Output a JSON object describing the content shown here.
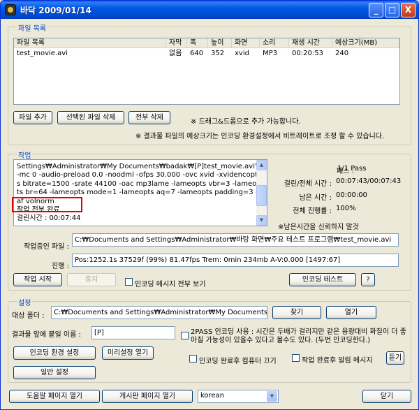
{
  "window": {
    "title": "바닥 2009/01/14",
    "btn_min": "_",
    "btn_max": "□",
    "btn_close": "X"
  },
  "file_list": {
    "group_label": "파일 목록",
    "columns": [
      "파일 목록",
      "자막",
      "폭",
      "높이",
      "화면",
      "소리",
      "재생 시간",
      "예상크기(MB)"
    ],
    "rows": [
      [
        "test_movie.avi",
        "없음",
        "640",
        "352",
        "xvid",
        "MP3",
        "00:20:53",
        "240"
      ]
    ],
    "add_button": "파일 추가",
    "delete_selected_button": "선택된 파일 삭제",
    "delete_all_button": "전부 삭제",
    "drag_hint": "※ 드래그&드롭으로 추가 가능합니다.",
    "size_hint": "※ 결과물 파일의 예상크기는 인코딩 환경설정에서 비트레이트로 조정 할 수 있습니다."
  },
  "job": {
    "group_label": "작업",
    "log": "Settings₩Administrator₩My Documents₩badak₩[P]test_movie.avi\" -mc 0 -audio-preload 0.0 -noodml -ofps 30.000 -ovc xvid -xvidencopts bitrate=1500 -srate 44100 -oac mp3lame -lameopts vbr=3  -lameopts br=64 -lameopts mode=1 -lameopts aq=7 -lameopts padding=3 -af volnorm\n작업 전부 완료\n걸린시간 : 00:07:44",
    "pass_label": "패스 :",
    "pass_value": "1/1 Pass",
    "elapsed_label": "걸린/전체 시간 :",
    "elapsed_value": "00:07:43/00:07:43",
    "remaining_label": "남은 시간 :",
    "remaining_value": "00:00:00",
    "progress_label": "전체 진행률 :",
    "progress_value": "100%",
    "note": "※남은시간을 신뢰하지 말것",
    "current_file_label": "작업중인 파일 :",
    "current_file_value": "C:₩Documents and Settings₩Administrator₩바탕 화면₩주요 테스트 프로그램₩test_movie.avi",
    "status_label": "진행 :",
    "status_value": "Pos:1252.1s  37529f (99%) 81.47fps Trem:    0min 234mb  A-V:0.000 [1497:67]",
    "start_button": "작업 시작",
    "stop_button": "중지",
    "show_all_messages": "인코딩 메시지 전부 보기",
    "encoding_test_button": "인코딩 테스트",
    "help_button": "?"
  },
  "settings": {
    "group_label": "설정",
    "target_folder_label": "대상 폴더 :",
    "target_folder_value": "C:₩Documents and Settings₩Administrator₩My Documents₩badak",
    "find_button": "찾기",
    "open_button": "열기",
    "prefix_label": "결과물 앞에 붙일 이름 :",
    "prefix_value": "[P]",
    "two_pass_text": "2PASS 인코딩 사용 : 시간은 두배가 걸리지만 같은 용량대비 화질이 더 좋아질 가능성이 있을수 있다고 볼수도 있다. (두번 인코딩한다.)",
    "encoding_settings_button": "인코딩 환경 설정",
    "preset_button": "미리설정 열기",
    "general_settings_button": "일반 설정",
    "shutdown_text": "인코딩 완료후 컴퓨터 끄기",
    "notify_text": "작업 완료후 알림 메시지",
    "notify_button": "듣기"
  },
  "footer": {
    "help_page_button": "도움말 페이지 열기",
    "board_page_button": "게시판 페이지 열기",
    "language_value": "korean",
    "close_button": "닫기"
  },
  "colors": {
    "group_label": "#0046d5",
    "highlight": "#e00000",
    "titlebar": "#0058e6"
  }
}
